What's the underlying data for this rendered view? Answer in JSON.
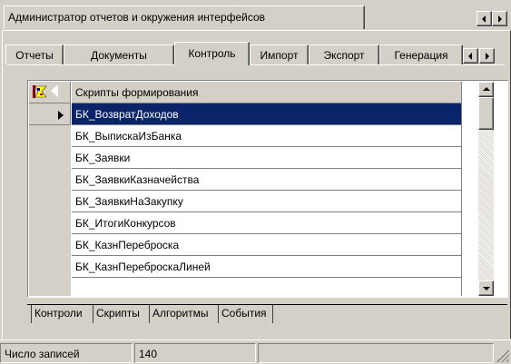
{
  "window": {
    "tab_title": "Администратор отчетов и окружения интерфейсов"
  },
  "tabs": [
    "Отчеты",
    "Документы",
    "Контроль",
    "Импорт",
    "Экспорт",
    "Генерация"
  ],
  "active_tab": "Контроль",
  "grid": {
    "header": "Скрипты формирования",
    "rows": [
      "БК_ВозвратДоходов",
      "БК_ВыпискаИзБанка",
      "БК_Заявки",
      "БК_ЗаявкиКазначейства",
      "БК_ЗаявкиНаЗакупку",
      "БК_ИтогиКонкурсов",
      "БК_КазнПереброска",
      "БК_КазнПереброскаЛиней"
    ],
    "selected_index": 0
  },
  "subtabs": [
    "Контроли",
    "Скрипты",
    "Алгоритмы",
    "События"
  ],
  "active_subtab": "Скрипты",
  "status": {
    "label": "Число записей",
    "count": "140"
  },
  "colors": {
    "face": "#d4d0c8",
    "selection": "#0a246a",
    "shadow": "#808080"
  },
  "icons": [
    "filter-icon",
    "row-pointer-icon",
    "scroll-left-icon",
    "scroll-right-icon",
    "scroll-up-icon",
    "scroll-down-icon",
    "size-grip-icon"
  ]
}
